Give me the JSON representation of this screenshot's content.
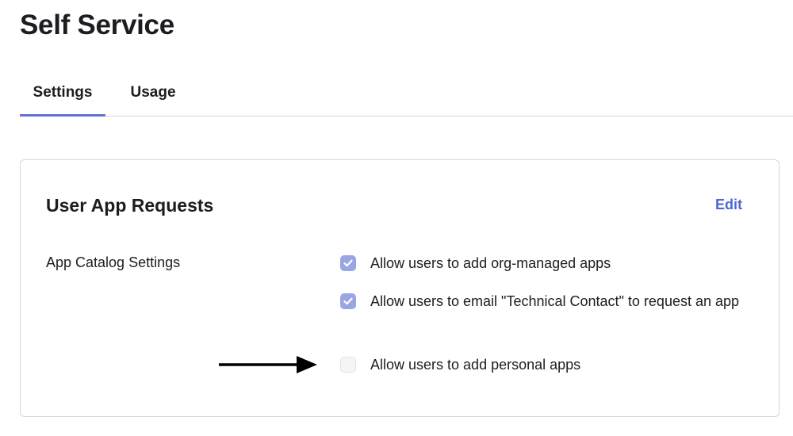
{
  "page": {
    "title": "Self Service"
  },
  "tabs": [
    {
      "label": "Settings",
      "active": true
    },
    {
      "label": "Usage",
      "active": false
    }
  ],
  "card": {
    "title": "User App Requests",
    "edit_label": "Edit",
    "section_label": "App Catalog Settings",
    "options": [
      {
        "label": "Allow users to add org-managed apps",
        "checked": true
      },
      {
        "label": "Allow users to email \"Technical Contact\" to request an app",
        "checked": true
      },
      {
        "label": "Allow users to add personal apps",
        "checked": false
      }
    ]
  },
  "icons": {
    "checkmark": "check-icon",
    "arrow": "arrow-right-icon"
  },
  "colors": {
    "accent": "#6073cf",
    "link": "#5066d1",
    "checkbox_checked": "#9aa5e3",
    "border": "#d7d7dc"
  }
}
